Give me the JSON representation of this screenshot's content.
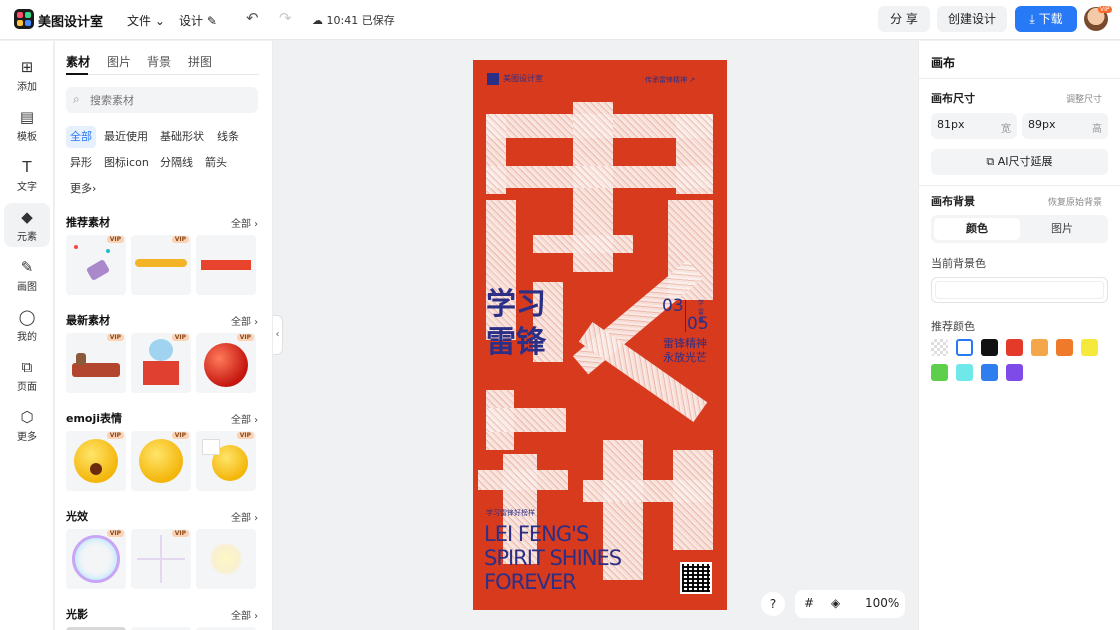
{
  "header": {
    "brand": "美图设计室",
    "menu_file": "文件",
    "menu_design": "设计",
    "saved_status": "10:41 已保存",
    "share_label": "分 享",
    "create_label": "创建设计",
    "download_label": "下载",
    "avatar_badge": "VIP"
  },
  "rail": [
    {
      "icon": "plus-square-icon",
      "label": "添加"
    },
    {
      "icon": "template-icon",
      "label": "模板"
    },
    {
      "icon": "text-icon",
      "label": "文字"
    },
    {
      "icon": "element-icon",
      "label": "元素"
    },
    {
      "icon": "brush-icon",
      "label": "画图"
    },
    {
      "icon": "user-icon",
      "label": "我的"
    },
    {
      "icon": "page-icon",
      "label": "页面"
    },
    {
      "icon": "more-icon",
      "label": "更多"
    }
  ],
  "panel": {
    "tabs": [
      "素材",
      "图片",
      "背景",
      "拼图"
    ],
    "search_placeholder": "搜索素材",
    "chips": [
      "全部",
      "最近使用",
      "基础形状",
      "线条",
      "异形",
      "图标icon",
      "分隔线",
      "箭头",
      "更多"
    ],
    "sections": [
      {
        "title": "推荐素材",
        "all": "全部"
      },
      {
        "title": "最新素材",
        "all": "全部"
      },
      {
        "title": "emoji表情",
        "all": "全部"
      },
      {
        "title": "光效",
        "all": "全部"
      },
      {
        "title": "光影",
        "all": "全部"
      }
    ],
    "vip_badge": "VIP"
  },
  "poster": {
    "brand": "美图设计室",
    "top_right": "传承雷锋精神 ↗",
    "title_line1": "学习",
    "title_line2": "雷锋",
    "date_month": "03",
    "date_day": "05",
    "date_small": "学雷锋",
    "slogan_line1": "雷锋精神",
    "slogan_line2": "永放光芒",
    "small_caption": "学习雷锋好榜样",
    "en_line1": "LEI FENG'S",
    "en_line2": "SPIRIT SHINES",
    "en_line3": "FOREVER"
  },
  "bottom": {
    "help": "?",
    "zoom": "100%"
  },
  "right": {
    "title": "画布",
    "size_label": "画布尺寸",
    "adjust_size": "调整尺寸",
    "width_value": "81px",
    "width_unit": "宽",
    "height_value": "89px",
    "height_unit": "高",
    "ai_extend": "AI尺寸延展",
    "bg_label": "画布背景",
    "restore_bg": "恢复原始背景",
    "seg_color": "颜色",
    "seg_image": "图片",
    "current_bg": "当前背景色",
    "recommend_colors": "推荐颜色",
    "swatches": [
      "transparent",
      "#ffffff",
      "#111111",
      "#e33a2a",
      "#f3a64a",
      "#ee7a2a",
      "#f5ea3c",
      "#5ecf4a",
      "#6fe8ea",
      "#2f7ef0",
      "#7e4ae8"
    ]
  },
  "colors": {
    "accent": "#2879f5",
    "poster_red": "#d83a1e",
    "poster_ink": "#2c2f86"
  }
}
